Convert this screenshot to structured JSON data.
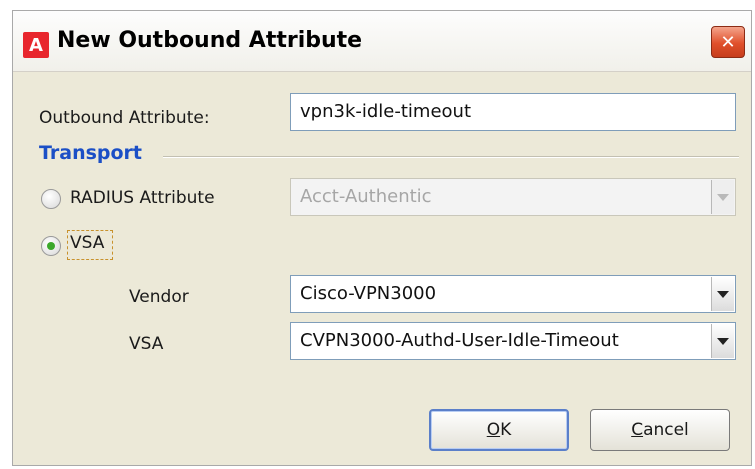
{
  "window": {
    "title": "New Outbound Attribute",
    "app_icon_letter": "A",
    "close_glyph": "✕"
  },
  "form": {
    "outbound_attribute_label": "Outbound Attribute:",
    "outbound_attribute_value": "vpn3k-idle-timeout",
    "transport_title": "Transport",
    "radius_label": "RADIUS Attribute",
    "radius_value": "Acct-Authentic",
    "vsa_radio_label": "VSA",
    "vendor_label": "Vendor",
    "vendor_value": "Cisco-VPN3000",
    "vsa_label": "VSA",
    "vsa_value": "CVPN3000-Authd-User-Idle-Timeout",
    "selected_transport": "VSA"
  },
  "buttons": {
    "ok_mnemonic": "O",
    "ok_rest": "K",
    "cancel_mnemonic": "C",
    "cancel_rest": "ancel"
  },
  "colors": {
    "accent_blue": "#1b4fc6",
    "app_icon_red": "#e8262d",
    "radio_green": "#3ba82b"
  }
}
